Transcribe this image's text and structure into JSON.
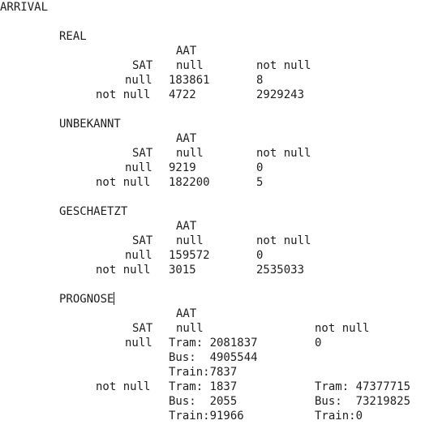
{
  "title": "ARRIVAL",
  "sections": [
    {
      "name": "REAL",
      "col_header": "AAT",
      "row_header": "SAT",
      "col_null": "null",
      "col_not_null": "not null",
      "rows": [
        {
          "label": "null",
          "null": "183861",
          "not_null": "8"
        },
        {
          "label": "not null",
          "null": "4722",
          "not_null": "2929243"
        }
      ]
    },
    {
      "name": "UNBEKANNT",
      "col_header": "AAT",
      "row_header": "SAT",
      "col_null": "null",
      "col_not_null": "not null",
      "rows": [
        {
          "label": "null",
          "null": "9219",
          "not_null": "0"
        },
        {
          "label": "not null",
          "null": "182200",
          "not_null": "5"
        }
      ]
    },
    {
      "name": "GESCHAETZT",
      "col_header": "AAT",
      "row_header": "SAT",
      "col_null": "null",
      "col_not_null": "not null",
      "rows": [
        {
          "label": "null",
          "null": "159572",
          "not_null": "0"
        },
        {
          "label": "not null",
          "null": "3015",
          "not_null": "2535033"
        }
      ]
    },
    {
      "name": "PROGNOSE",
      "col_header": "AAT",
      "row_header": "SAT",
      "col_null": "null",
      "col_not_null": "not null",
      "rows": [
        {
          "label": "null",
          "null": [
            "Tram: 2081837",
            "Bus:  4905544",
            "Train:7837"
          ],
          "not_null": [
            "0"
          ]
        },
        {
          "label": "not null",
          "null": [
            "Tram: 1837",
            "Bus:  2055",
            "Train:91966"
          ],
          "not_null": [
            "Tram: 47377715",
            "Bus:  73219825",
            "Train:0"
          ]
        }
      ]
    }
  ]
}
